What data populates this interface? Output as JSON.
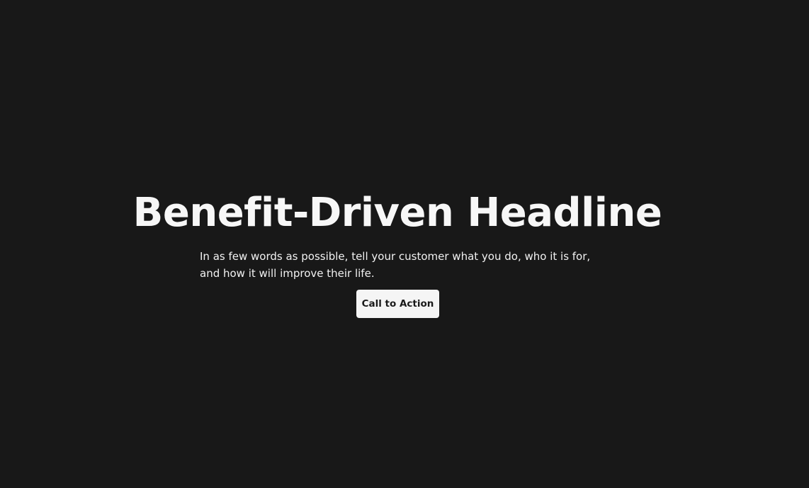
{
  "hero": {
    "headline": "Benefit-Driven Headline",
    "subtext": "In as few words as possible, tell your customer what you do, who it is for, and how it will improve their life.",
    "cta_label": "Call to Action"
  },
  "colors": {
    "background": "#181818",
    "headline": "#f7f7f7",
    "subtext": "#f2f2f2",
    "cta_background": "#f5f5f5",
    "cta_text": "#1a1a1a"
  }
}
